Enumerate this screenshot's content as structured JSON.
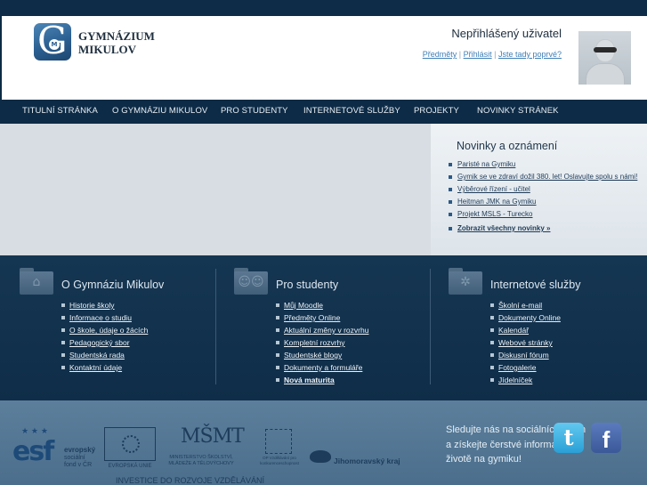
{
  "brand": {
    "line1": "GYMNÁZIUM",
    "line2": "MIKULOV",
    "logo_letter": "G",
    "logo_small": "M"
  },
  "user": {
    "status": "Nepřihlášený uživatel",
    "links": [
      "Předměty",
      "Přihlásit",
      "Jste tady poprvé?"
    ],
    "separator": " | "
  },
  "nav": {
    "items": [
      "TITULNÍ STRÁNKA",
      "O GYMNÁZIU MIKULOV",
      "PRO STUDENTY",
      "INTERNETOVÉ SLUŽBY",
      "PROJEKTY",
      "NOVINKY STRÁNEK"
    ]
  },
  "news": {
    "title": "Novinky a oznámení",
    "items": [
      "Paristé na Gymiku",
      "Gymik se ve zdraví dožil 380. let! Oslavujte spolu s námi!",
      "Výběrové řízení - učitel",
      "Heitman JMK na Gymiku",
      "Projekt MSLS - Turecko"
    ],
    "all_label": "Zobrazit všechny novinky »"
  },
  "columns": [
    {
      "title": "O Gymnáziu Mikulov",
      "icon": "home-icon",
      "items": [
        "Historie školy",
        "Informace o studiu",
        "O škole, údaje o žácích",
        "Pedagogický sbor",
        "Studentská rada",
        "Kontaktní údaje"
      ],
      "bold_last": false
    },
    {
      "title": "Pro studenty",
      "icon": "people-icon",
      "items": [
        "Můj Moodle",
        "Předměty Online",
        "Aktuální změny v rozvrhu",
        "Kompletní rozvrhy",
        "Studentské blogy",
        "Dokumenty a formuláře",
        "Nová maturita"
      ],
      "bold_last": true
    },
    {
      "title": "Internetové služby",
      "icon": "network-icon",
      "items": [
        "Školní e-mail",
        "Dokumenty Online",
        "Kalendář",
        "Webové stránky",
        "Diskusní fórum",
        "Fotogalerie",
        "Jídelníček"
      ],
      "bold_last": false
    }
  ],
  "footer": {
    "esf_big": "esf",
    "esf_stars": "★ ★ ★",
    "esf_line1": "evropský",
    "esf_line2": "sociální",
    "esf_line3": "fond v ČR",
    "eu_label": "EVROPSKÁ UNIE",
    "msmt_mark": "MŠMT",
    "msmt_label": "MINISTERSTVO ŠKOLSTVÍ, MLÁDEŽE A TĚLOVÝCHOVY",
    "op_label": "OP Vzdělávání pro konkurenceschopnost",
    "jmk_label": "Jihomoravský kraj",
    "invest": "INVESTICE DO ROZVOJE VZDĚLÁVÁNÍ",
    "social_text": "Sledujte nás na sociálních sítích a získejte čerstvé informace o životě na gymiku!",
    "twitter_glyph": "t",
    "facebook_glyph": "f"
  }
}
